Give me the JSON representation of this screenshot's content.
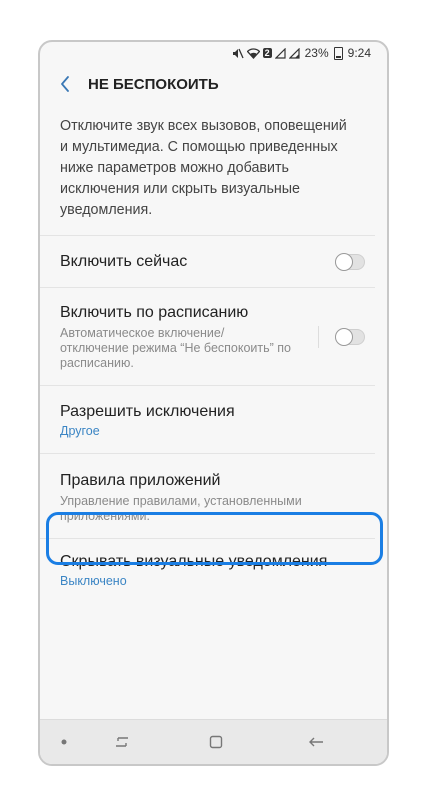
{
  "status_bar": {
    "battery_percent": "23%",
    "time": "9:24",
    "sim_badge": "2"
  },
  "header": {
    "title": "НЕ БЕСПОКОИТЬ"
  },
  "description": "Отключите звук всех вызовов, оповещений и мультимедиа. С помощью приведенных ниже параметров можно добавить исключения или скрыть визуальные уведомления.",
  "items": [
    {
      "title": "Включить сейчас",
      "toggle_on": false
    },
    {
      "title": "Включить по расписанию",
      "subtitle": "Автоматическое включение/ отключение режима “Не беспокоить” по расписанию.",
      "toggle_on": false
    },
    {
      "title": "Разрешить исключения",
      "subtitle": "Другое"
    },
    {
      "title": "Правила приложений",
      "subtitle": "Управление правилами, установленными приложениями."
    },
    {
      "title": "Скрывать визуальные уведомления",
      "subtitle": "Выключено"
    }
  ],
  "colors": {
    "accent": "#3b85c4",
    "highlight": "#1a7ee4"
  }
}
